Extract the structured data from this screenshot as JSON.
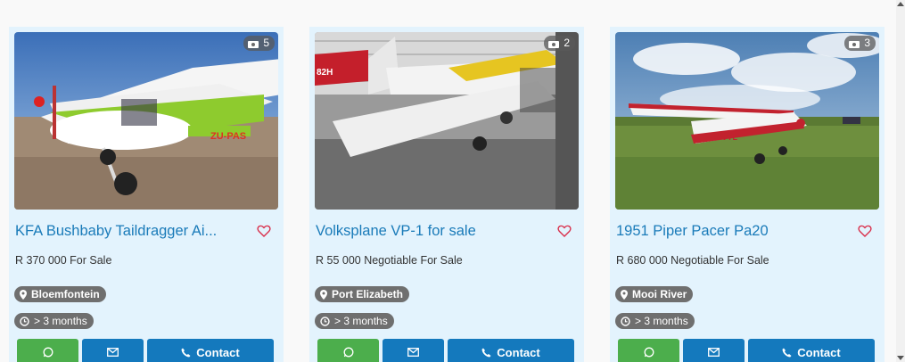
{
  "listings": [
    {
      "photo_count": "5",
      "title": "KFA Bushbaby Taildragger Ai...",
      "price_text": "R 370 000 For Sale",
      "location": "Bloemfontein",
      "age": "> 3 months",
      "contact_label": "Contact"
    },
    {
      "photo_count": "2",
      "title": "Volksplane VP-1 for sale",
      "price_text": "R 55 000 Negotiable For Sale",
      "location": "Port Elizabeth",
      "age": "> 3 months",
      "contact_label": "Contact"
    },
    {
      "photo_count": "3",
      "title": "1951 Piper Pacer Pa20",
      "price_text": "R 680 000 Negotiable For Sale",
      "location": "Mooi River",
      "age": "> 3 months",
      "contact_label": "Contact"
    }
  ],
  "icons": {
    "photo_badge": "camera-icon",
    "favorite": "heart-icon",
    "location": "map-marker-icon",
    "time": "clock-icon",
    "whatsapp": "whatsapp-icon",
    "email": "envelope-icon",
    "contact": "phone-icon"
  },
  "colors": {
    "card_bg": "#e3f3fd",
    "title": "#1a7bb9",
    "whatsapp_btn": "#4cae4c",
    "primary_btn": "#1479bd",
    "heart": "#d9304c",
    "pill_bg": "#6f6f6f"
  }
}
